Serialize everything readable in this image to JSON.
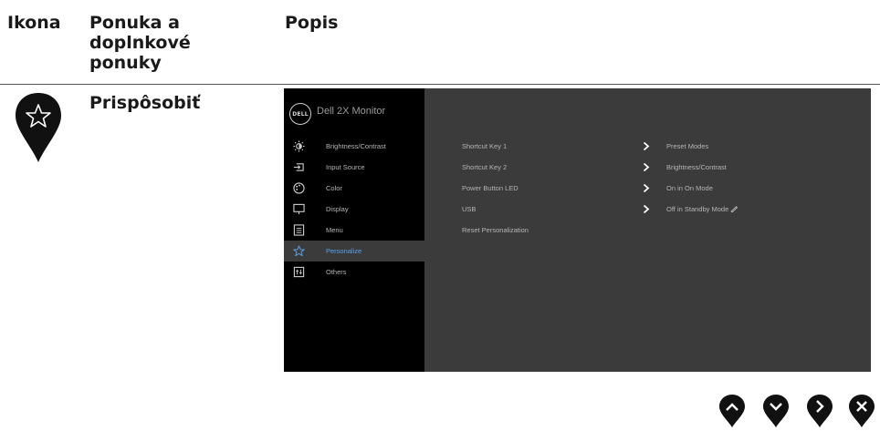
{
  "header": {
    "col_icon": "Ikona",
    "col_menu": "Ponuka a doplnkové ponuky",
    "col_desc": "Popis"
  },
  "row": {
    "title": "Prispôsobiť",
    "icon": "star-icon"
  },
  "osd": {
    "logo": "DELL",
    "model": "Dell 2X Monitor",
    "menu": [
      {
        "label": "Brightness/Contrast",
        "icon": "brightness-icon"
      },
      {
        "label": "Input Source",
        "icon": "input-source-icon"
      },
      {
        "label": "Color",
        "icon": "color-palette-icon"
      },
      {
        "label": "Display",
        "icon": "display-icon"
      },
      {
        "label": "Menu",
        "icon": "menu-icon"
      },
      {
        "label": "Personalize",
        "icon": "star-icon",
        "active": true
      },
      {
        "label": "Others",
        "icon": "others-icon"
      }
    ],
    "options": [
      {
        "label": "Shortcut Key 1",
        "value": "Preset Modes"
      },
      {
        "label": "Shortcut Key 2",
        "value": "Brightness/Contrast"
      },
      {
        "label": "Power Button LED",
        "value": "On in On Mode"
      },
      {
        "label": "USB",
        "value": "Off in Standby Mode"
      },
      {
        "label": "Reset Personalization",
        "value": ""
      }
    ],
    "accent": "#5aa3e8"
  },
  "nav_buttons": [
    "up-icon",
    "down-icon",
    "right-icon",
    "close-icon"
  ]
}
